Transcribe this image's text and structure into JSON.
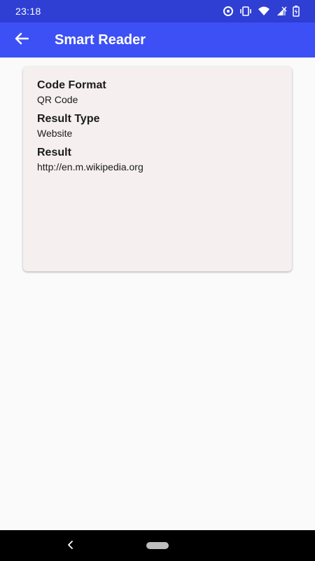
{
  "status_bar": {
    "time": "23:18",
    "icons": [
      "sync-icon",
      "vibrate-icon",
      "wifi-icon",
      "signal-icon",
      "battery-icon"
    ]
  },
  "app_bar": {
    "back_icon": "arrow-back-icon",
    "title": "Smart Reader"
  },
  "result_card": {
    "fields": [
      {
        "label": "Code Format",
        "value": "QR Code"
      },
      {
        "label": "Result Type",
        "value": "Website"
      },
      {
        "label": "Result",
        "value": "http://en.m.wikipedia.org"
      }
    ]
  },
  "nav_bar": {
    "back_icon": "chevron-left-icon",
    "home_icon": "home-pill-icon"
  },
  "colors": {
    "status_bar": "#2f3fd4",
    "app_bar": "#3d50f5",
    "card_background": "#f5f0ef",
    "page_background": "#fafafa"
  }
}
